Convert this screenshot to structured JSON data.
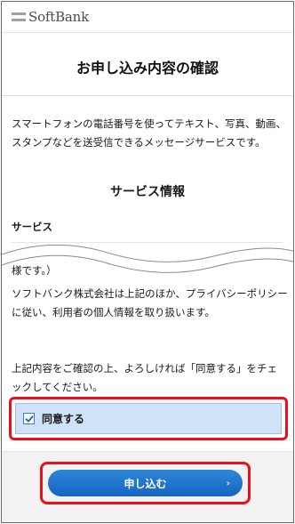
{
  "header": {
    "logo_text": "SoftBank",
    "title": "お申し込み内容の確認"
  },
  "main": {
    "intro": "スマートフォンの電話番号を使ってテキスト、写真、動画、スタンプなどを送受信できるメッセージサービスです。",
    "section_title": "サービス情報",
    "service_label": "サービス",
    "continued_text_1": "様です。）",
    "continued_text_2": "ソフトバンク株式会社は上記のほか、プライバシーポリシーに従い、利用者の個人情報を取り扱います。",
    "confirm_text": "上記内容をご確認の上、よろしければ「同意する」をチェックしてください。",
    "agree_label": "同意する",
    "agree_checked": true,
    "submit_label": "申し込む"
  },
  "colors": {
    "highlight_red": "#e8111c",
    "button_blue": "#1e74cc",
    "agree_background": "#cfe2f8"
  }
}
